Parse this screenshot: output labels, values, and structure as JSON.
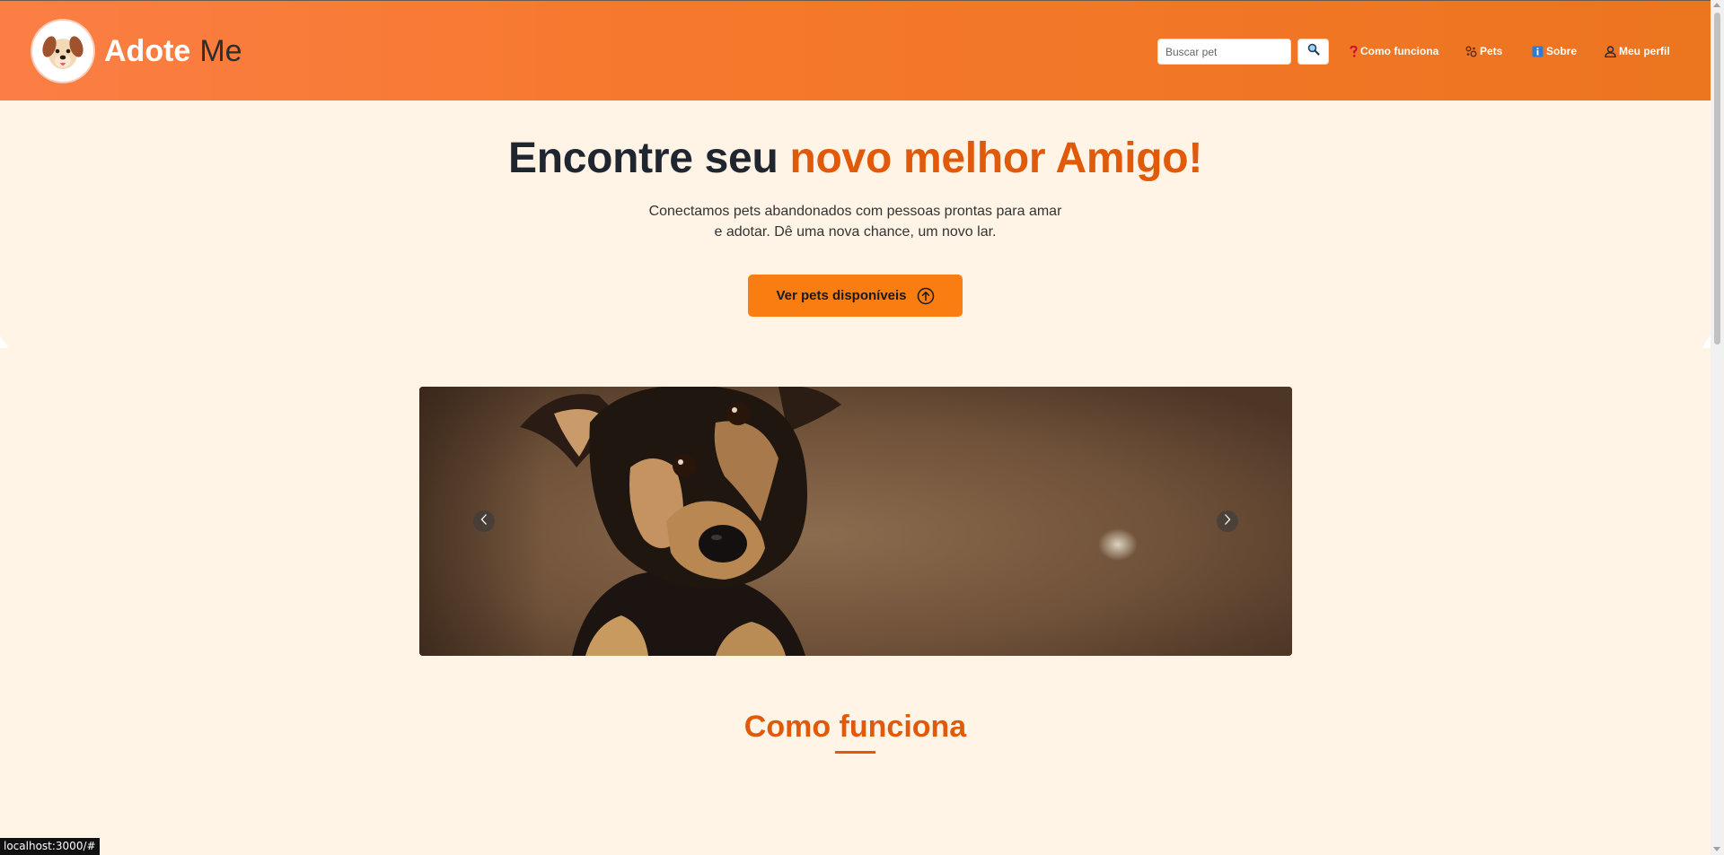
{
  "header": {
    "brand_bold": "Adote",
    "brand_thin": "Me",
    "search": {
      "placeholder": "Buscar pet"
    },
    "nav": [
      {
        "label": "Como funciona",
        "icon": "question-icon"
      },
      {
        "label": "Pets",
        "icon": "paw-icon"
      },
      {
        "label": "Sobre",
        "icon": "info-icon"
      },
      {
        "label": "Meu perfil",
        "icon": "user-icon"
      }
    ]
  },
  "hero": {
    "title_plain": "Encontre seu",
    "title_accent": "novo melhor Amigo!",
    "subtitle_line1": "Conectamos pets abandonados com pessoas prontas para amar",
    "subtitle_line2": "e adotar. Dê uma nova chance, um novo lar.",
    "cta_label": "Ver pets disponíveis"
  },
  "carousel": {
    "prev_icon": "chevron-left-icon",
    "next_icon": "chevron-right-icon"
  },
  "section": {
    "title": "Como funciona"
  },
  "status_bar": {
    "url": "localhost:3000/#"
  },
  "colors": {
    "header_start": "#fb7e45",
    "header_end": "#ec7520",
    "accent": "#e05a0a",
    "cta": "#f97d10",
    "background": "#fff4e6"
  }
}
